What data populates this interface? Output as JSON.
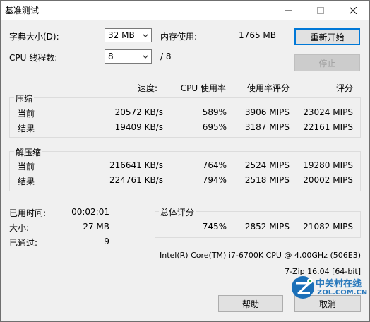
{
  "window": {
    "title": "基准测试"
  },
  "controls": {
    "dict_label": "字典大小(D):",
    "dict_value": "32 MB",
    "mem_label": "内存使用:",
    "mem_value": "1765 MB",
    "threads_label": "CPU 线程数:",
    "threads_value": "8",
    "threads_total": "/ 8",
    "restart_button": "重新开始",
    "stop_button": "停止"
  },
  "columns": {
    "speed": "速度:",
    "cpu": "CPU 使用率",
    "rating_usage": "使用率评分",
    "rating": "评分"
  },
  "compress": {
    "title": "压缩",
    "rows": [
      {
        "label": "当前",
        "speed": "20572 KB/s",
        "cpu": "589%",
        "usage": "3906 MIPS",
        "rating": "23024 MIPS"
      },
      {
        "label": "结果",
        "speed": "19409 KB/s",
        "cpu": "695%",
        "usage": "3187 MIPS",
        "rating": "22161 MIPS"
      }
    ]
  },
  "decompress": {
    "title": "解压缩",
    "rows": [
      {
        "label": "当前",
        "speed": "216641 KB/s",
        "cpu": "764%",
        "usage": "2524 MIPS",
        "rating": "19280 MIPS"
      },
      {
        "label": "结果",
        "speed": "224761 KB/s",
        "cpu": "794%",
        "usage": "2518 MIPS",
        "rating": "20002 MIPS"
      }
    ]
  },
  "stats": {
    "elapsed_label": "已用时间:",
    "elapsed_value": "00:02:01",
    "size_label": "大小:",
    "size_value": "27 MB",
    "passed_label": "已通过:",
    "passed_value": "9"
  },
  "total": {
    "title": "总体评分",
    "cpu": "745%",
    "usage": "2852 MIPS",
    "rating": "21082 MIPS"
  },
  "cpu_info": "Intel(R) Core(TM) i7-6700K CPU @ 4.00GHz (506E3)",
  "version": "7-Zip 16.04 [64-bit]",
  "buttons": {
    "help": "帮助",
    "cancel": "取消"
  },
  "watermark": {
    "brand_cn": "中关村在线",
    "brand_en": "ZOL.COM.CN"
  }
}
